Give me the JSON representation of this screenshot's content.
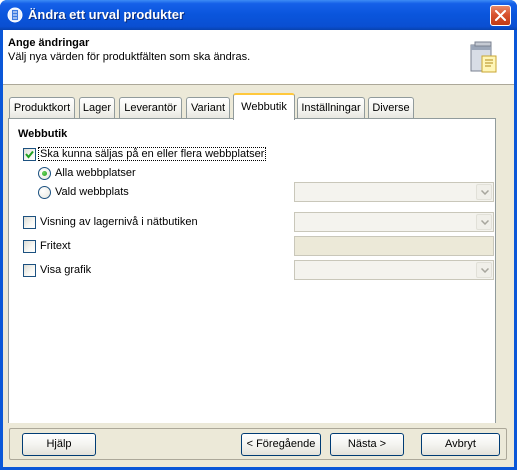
{
  "window": {
    "title": "Ändra ett urval produkter"
  },
  "header": {
    "title": "Ange ändringar",
    "subtitle": "Välj nya värden för produktfälten som ska ändras."
  },
  "tabs": [
    {
      "label": "Produktkort",
      "active": false
    },
    {
      "label": "Lager",
      "active": false
    },
    {
      "label": "Leverantör",
      "active": false
    },
    {
      "label": "Variant",
      "active": false
    },
    {
      "label": "Webbutik",
      "active": true
    },
    {
      "label": "Inställningar",
      "active": false
    },
    {
      "label": "Diverse",
      "active": false
    }
  ],
  "webshop": {
    "section_title": "Webbutik",
    "sellable_label": "Ska kunna säljas på en eller flera webbplatser",
    "sellable_checked": true,
    "all_sites_label": "Alla webbplatser",
    "all_sites_selected": true,
    "selected_site_label": "Vald webbplats",
    "selected_site_value": "",
    "stock_display_label": "Visning av lagernivå i nätbutiken",
    "stock_display_checked": false,
    "stock_display_value": "",
    "freetext_label": "Fritext",
    "freetext_checked": false,
    "freetext_value": "",
    "graphics_label": "Visa grafik",
    "graphics_checked": false,
    "graphics_value": ""
  },
  "footer": {
    "help_label": "Hjälp",
    "prev_label": "< Föregående",
    "next_label": "Nästa >",
    "cancel_label": "Avbryt"
  },
  "colors": {
    "titlebar": "#0A55DC",
    "dialog_bg": "#ECE9D8",
    "active_tab_accent": "#FFC83C"
  }
}
